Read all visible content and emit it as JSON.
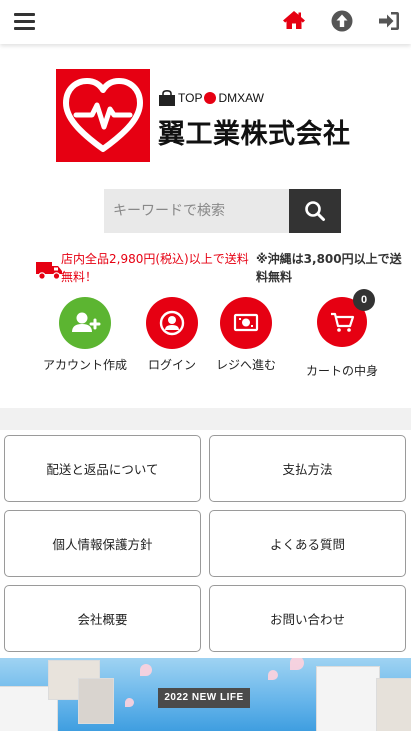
{
  "header": {
    "menu_icon": "hamburger-icon",
    "home_icon": "home-icon",
    "scroll_top_icon": "arrow-up-circle-icon",
    "login_icon": "sign-in-icon"
  },
  "brand": {
    "tagline": "TOP",
    "tagline_suffix": "DMXAW",
    "name": "翼工業株式会社",
    "logo_color": "#e60012"
  },
  "search": {
    "placeholder": "キーワードで検索",
    "button_icon": "search-icon"
  },
  "shipping": {
    "line1": "店内全品2,980円(税込)以上で送料",
    "line2": "無料！",
    "note": "※沖縄は3,800円以上で送料無料"
  },
  "actions": [
    {
      "label": "アカウント作成",
      "icon": "add-user-icon",
      "color": "#5cb531"
    },
    {
      "label": "ログイン",
      "icon": "user-icon",
      "color": "#e60012"
    },
    {
      "label": "レジへ進む",
      "icon": "cash-icon",
      "color": "#e60012"
    },
    {
      "label": "カートの中身",
      "icon": "cart-icon",
      "color": "#e60012",
      "badge": "0"
    }
  ],
  "menu_tiles": [
    "配送と返品について",
    "支払方法",
    "個人情報保護方針",
    "よくある質問",
    "会社概要",
    "お問い合わせ"
  ],
  "banner": {
    "sign_text": "2022 NEW LIFE"
  },
  "colors": {
    "accent": "#e60012",
    "green": "#5cb531",
    "dark": "#333333"
  }
}
